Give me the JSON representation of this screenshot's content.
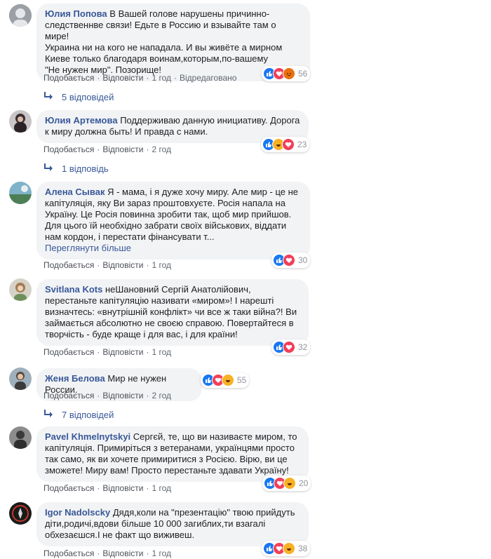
{
  "actions": {
    "like": "Подобається",
    "reply": "Відповісти",
    "edited": "Відредаговано",
    "see_more": "Переглянути більше"
  },
  "comments": [
    {
      "author": "Юлия Попова",
      "text": "В Вашей голове нарушены причинно-\nследственнве связи! Едьте в Россию и взывайте там о мире!\nУкраина ни на кого не нападала. И вы живёте а мирном\nКиеве только благодаря воинам,которым,по-вашему\n\"Не нужен мир\". Позорище!",
      "time": "1 год",
      "edited": true,
      "reactions": [
        "like-icon",
        "love-icon",
        "angry-icon"
      ],
      "count": "56",
      "replies": "5 відповідей"
    },
    {
      "author": "Юлия Артемова",
      "text": "Поддерживаю данную инициативу. Дорога\nк миру должна быть! И правда с нами.",
      "time": "2 год",
      "reactions": [
        "like-icon",
        "haha-icon",
        "love-icon"
      ],
      "count": "23",
      "replies": "1 відповідь"
    },
    {
      "author": "Алена Сывак",
      "text": "Я - мама, і я дуже хочу миру. Але мир - це не\nкапітуляція, яку Ви зараз проштовхуєте. Росія напала на\nУкраїну. Це Росія повинна зробити так, щоб мир прийшов.\nДля цього їй необхідно забрати своїх військових, віддати\nнам кордон, і перестати фінансувати т...",
      "see_more": true,
      "time": "1 год",
      "reactions": [
        "like-icon",
        "love-icon"
      ],
      "count": "30"
    },
    {
      "author": "Svitlana Kots",
      "text": "неШановний Сергій Анатолійович,\nперестаньте капітуляцію називати «миром»! І нарешті\nвизначтесь: «внутрішній конфлікт» чи все ж таки війна?! Ви\nзаймається абсолютно не своєю справою. Повертайтеся в\nтворчість - буде краще і для вас, і для країни!",
      "time": "1 год",
      "reactions": [
        "like-icon",
        "love-icon"
      ],
      "count": "32"
    },
    {
      "author": "Женя Белова",
      "text": "Мир не нужен России.",
      "time": "2 год",
      "reactions": [
        "like-icon",
        "love-icon",
        "haha-icon"
      ],
      "count": "55",
      "replies": "7 відповідей"
    },
    {
      "author": "Pavel Khmelnytskyi",
      "text": "Сергєй, те, що ви називаєте миром, то\nкапітуляція. Примиріться з ветеранами, українцями просто\nтак само, як ви хочете примиритися з Росією. Вірю, ви це\nзможете! Миру вам! Просто перестаньте здавати Україну!",
      "time": "1 год",
      "reactions": [
        "like-icon",
        "love-icon",
        "haha-icon"
      ],
      "count": "20"
    },
    {
      "author": "Igor Nadolscky",
      "text": "Дядя,коли на \"презентацію\" твою прийдуть\nдіти,родичі,вдови більше 10 000 загиблих,ти взагалі\nобхезаєшся.І не факт що виживеш.",
      "time": "1 год",
      "reactions": [
        "like-icon",
        "love-icon",
        "haha-icon"
      ],
      "count": "38"
    }
  ]
}
